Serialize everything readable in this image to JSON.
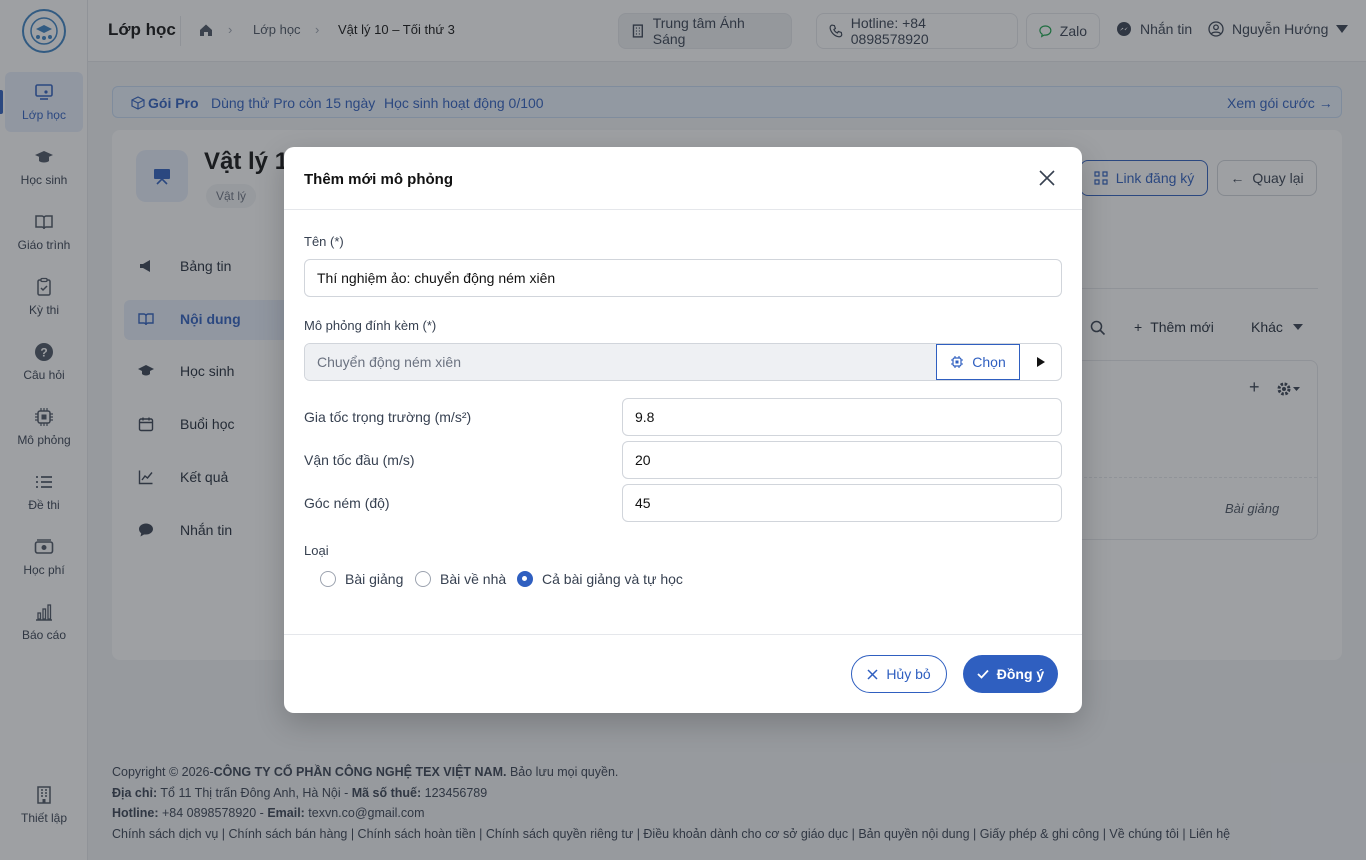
{
  "sidebar": {
    "items": [
      {
        "label": "Lớp học",
        "icon": "classroom-icon",
        "active": true
      },
      {
        "label": "Học sinh",
        "icon": "graduation-cap-icon"
      },
      {
        "label": "Giáo trình",
        "icon": "book-icon"
      },
      {
        "label": "Kỳ thi",
        "icon": "clipboard-icon"
      },
      {
        "label": "Câu hỏi",
        "icon": "question-icon"
      },
      {
        "label": "Mô phỏng",
        "icon": "chip-icon"
      },
      {
        "label": "Đề thi",
        "icon": "list-icon"
      },
      {
        "label": "Học phí",
        "icon": "money-icon"
      },
      {
        "label": "Báo cáo",
        "icon": "bar-chart-icon"
      }
    ],
    "settings_label": "Thiết lập"
  },
  "header": {
    "title": "Lớp học",
    "breadcrumb": [
      "Lớp học",
      "Vật lý 10 – Tối thứ 3"
    ],
    "center_label": "Trung tâm Ánh Sáng",
    "hotline": "Hotline: +84 0898578920",
    "zalo": "Zalo",
    "messages": "Nhắn tin",
    "user": "Nguyễn Hướng"
  },
  "banner": {
    "plan": "Gói Pro",
    "trial": "Dùng thử Pro còn 15 ngày",
    "students": "Học sinh hoạt động 0/100",
    "link": "Xem gói cước →"
  },
  "class": {
    "title": "Vật lý 10",
    "tag": "Vật lý",
    "register_link": "Link đăng ký",
    "back": "Quay lại"
  },
  "tabs": [
    {
      "label": "Bảng tin"
    },
    {
      "label": "Nội dung",
      "active": true
    },
    {
      "label": "Học sinh"
    },
    {
      "label": "Buổi học"
    },
    {
      "label": "Kết quả"
    },
    {
      "label": "Nhắn tin"
    }
  ],
  "content": {
    "add_new": "Thêm mới",
    "other": "Khác",
    "row_type": "Bài giảng"
  },
  "modal": {
    "title": "Thêm mới mô phỏng",
    "name_label": "Tên (*)",
    "name_value": "Thí nghiệm ảo: chuyển động ném xiên",
    "sim_label": "Mô phỏng đính kèm (*)",
    "sim_value": "Chuyển động ném xiên",
    "choose": "Chọn",
    "params": [
      {
        "label": "Gia tốc trọng trường (m/s²)",
        "value": "9.8"
      },
      {
        "label": "Vận tốc đầu (m/s)",
        "value": "20"
      },
      {
        "label": "Góc ném (độ)",
        "value": "45"
      }
    ],
    "type_label": "Loại",
    "types": [
      {
        "label": "Bài giảng",
        "selected": false
      },
      {
        "label": "Bài về nhà",
        "selected": false
      },
      {
        "label": "Cả bài giảng và tự học",
        "selected": true
      }
    ],
    "cancel": "Hủy bỏ",
    "ok": "Đồng ý"
  },
  "footer": {
    "copyright_prefix": "Copyright © 2026-",
    "company": "CÔNG TY CỔ PHẦN CÔNG NGHỆ TEX VIỆT NAM.",
    "rights": " Bảo lưu mọi quyền.",
    "address_label": "Địa chỉ:",
    "address": " Tổ 11 Thị trấn Đông Anh, Hà Nội - ",
    "tax_label": "Mã số thuế:",
    "tax": " 123456789",
    "hotline_label": "Hotline:",
    "hotline": " +84 0898578920 - ",
    "email_label": "Email:",
    "email": " texvn.co@gmail.com",
    "links": "Chính sách dịch vụ | Chính sách bán hàng | Chính sách hoàn tiền | Chính sách quyền riêng tư | Điều khoản dành cho cơ sở giáo dục | Bản quyền nội dung | Giấy phép & ghi công | Về chúng tôi | Liên hệ"
  }
}
